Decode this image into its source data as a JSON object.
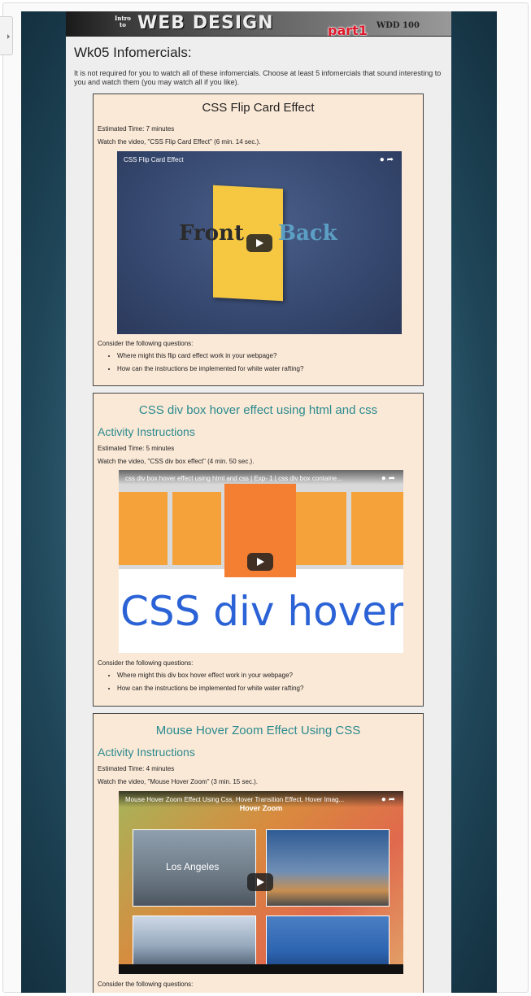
{
  "banner": {
    "intro": "Intro\nto",
    "title": "WEB DESIGN",
    "code": "WDD 100"
  },
  "part_mark": "part1",
  "page_title": "Wk05  Infomercials:",
  "intro_text": "It is not required for you to watch all of these infomercials.  Choose at least 5 infomercials that sound interesting to you and watch them (you may watch all if you like).",
  "cards": [
    {
      "title": "CSS Flip Card Effect",
      "heading": "",
      "time": "Estimated Time:  7 minutes",
      "watch": "Watch the video, \"CSS Flip Card Effect\" (6 min. 14 sec.).",
      "video_title": "CSS Flip Card Effect",
      "video_text_left": "Front",
      "video_text_right": "Back",
      "questions_label": "Consider the following questions:",
      "questions": [
        "Where might this flip card effect work in your webpage?",
        "How can the instructions be implemented for white water rafting?"
      ]
    },
    {
      "title": "CSS div box hover effect using html and css",
      "heading": "Activity Instructions",
      "time": "Estimated Time: 5 minutes",
      "watch": "Watch the video, \"CSS div box effect\" (4 min. 50 sec.).",
      "video_title": "css div box hover effect using html and css | Exp- 1 | css div box containe...",
      "video_text": "CSS div hover",
      "questions_label": "Consider the following questions:",
      "questions": [
        "Where might this div box hover effect work in your webpage?",
        "How can the instructions be implemented for white water rafting?"
      ]
    },
    {
      "title": "Mouse Hover Zoom Effect Using CSS",
      "heading": "Activity Instructions",
      "time": "Estimated Time: 4 minutes",
      "watch": "Watch the video, \"Mouse Hover Zoom\" (3 min. 15 sec.).",
      "video_title": "Mouse Hover Zoom Effect Using Css, Hover Transition Effect, Hover Imag...",
      "video_subtitle": "Hover Zoom",
      "video_city": "Los Angeles",
      "questions_label": "Consider the following questions:"
    }
  ],
  "colors": {
    "card_bg": "#fbe9d7",
    "accent_teal": "#2a8a8e",
    "part_red": "#e0192c"
  }
}
